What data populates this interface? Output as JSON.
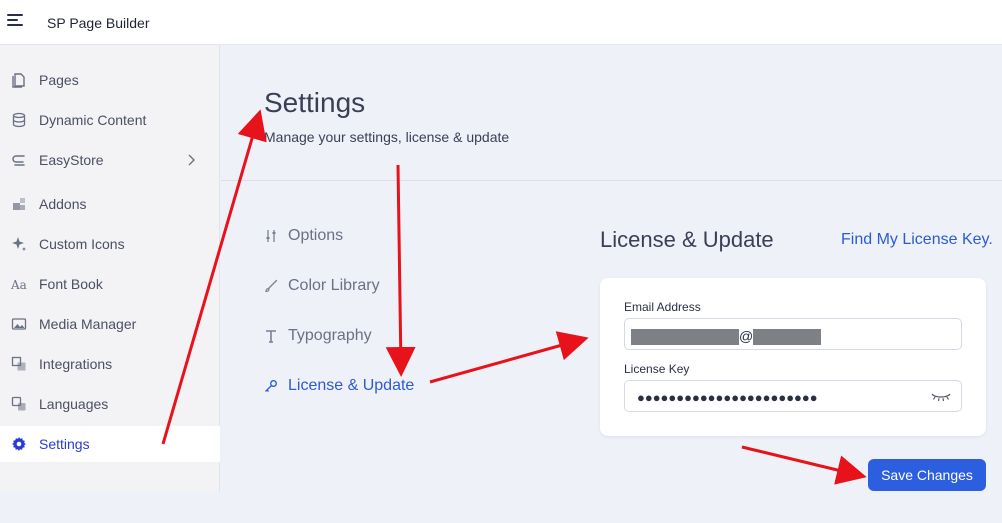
{
  "topbar": {
    "app_title": "SP Page Builder"
  },
  "sidebar": {
    "items": [
      {
        "label": "Pages",
        "icon": "pages-icon"
      },
      {
        "label": "Dynamic Content",
        "icon": "database-icon"
      },
      {
        "label": "EasyStore",
        "icon": "store-icon"
      },
      {
        "label": "Addons",
        "icon": "addons-icon"
      },
      {
        "label": "Custom Icons",
        "icon": "sparkle-icon"
      },
      {
        "label": "Font Book",
        "icon": "font-icon"
      },
      {
        "label": "Media Manager",
        "icon": "image-icon"
      },
      {
        "label": "Integrations",
        "icon": "integrations-icon"
      },
      {
        "label": "Languages",
        "icon": "translate-icon"
      },
      {
        "label": "Settings",
        "icon": "gear-icon",
        "active": true
      }
    ]
  },
  "settings": {
    "title": "Settings",
    "subtitle": "Manage your settings, license & update",
    "nav": [
      {
        "label": "Options"
      },
      {
        "label": "Color Library"
      },
      {
        "label": "Typography"
      },
      {
        "label": "License & Update",
        "active": true
      }
    ]
  },
  "license": {
    "section_title": "License & Update",
    "find_link": "Find My License Key.",
    "email_label": "Email Address",
    "email_at": "@",
    "key_label": "License Key",
    "key_masked": "●●●●●●●●●●●●●●●●●●●●●●●",
    "save_label": "Save Changes"
  },
  "colors": {
    "accent": "#2b5fe0",
    "active_sidebar": "#2b3bd6",
    "annotation_arrow": "#e8121a"
  }
}
